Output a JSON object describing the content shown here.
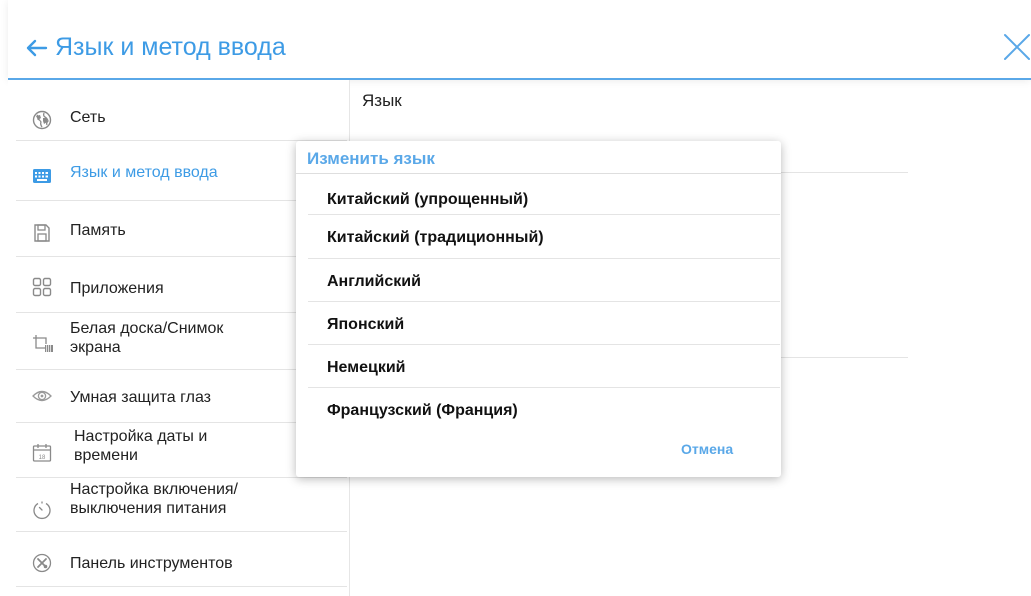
{
  "header": {
    "title": "Язык и метод ввода"
  },
  "sidebar": {
    "items": [
      {
        "label": "Сеть",
        "icon": "globe-icon"
      },
      {
        "label": "Язык и метод ввода",
        "icon": "keyboard-icon",
        "active": true
      },
      {
        "label": "Память",
        "icon": "storage-icon"
      },
      {
        "label": "Приложения",
        "icon": "apps-grid-icon"
      },
      {
        "label": "Белая доска/Снимок\nэкрана",
        "icon": "crop-screenshot-icon"
      },
      {
        "label": "Умная защита глаз",
        "icon": "eye-icon"
      },
      {
        "label": "Настройка даты и\nвремени",
        "icon": "calendar-icon",
        "icon_text": "18"
      },
      {
        "label": "Настройка включения/\nвыключения питания",
        "icon": "power-timer-icon"
      },
      {
        "label": "Панель инструментов",
        "icon": "tools-icon"
      }
    ]
  },
  "content": {
    "title": "Язык"
  },
  "dialog": {
    "title": "Изменить язык",
    "options": [
      "Китайский (упрощенный)",
      "Китайский (традиционный)",
      "Английский",
      "Японский",
      "Немецкий",
      "Французский (Франция)"
    ],
    "cancel_label": "Отмена"
  },
  "colors": {
    "accent": "#3d9be5",
    "accent_light": "#5aa8e8",
    "divider": "#e4e4e4",
    "icon_gray": "#8a8a8a"
  }
}
